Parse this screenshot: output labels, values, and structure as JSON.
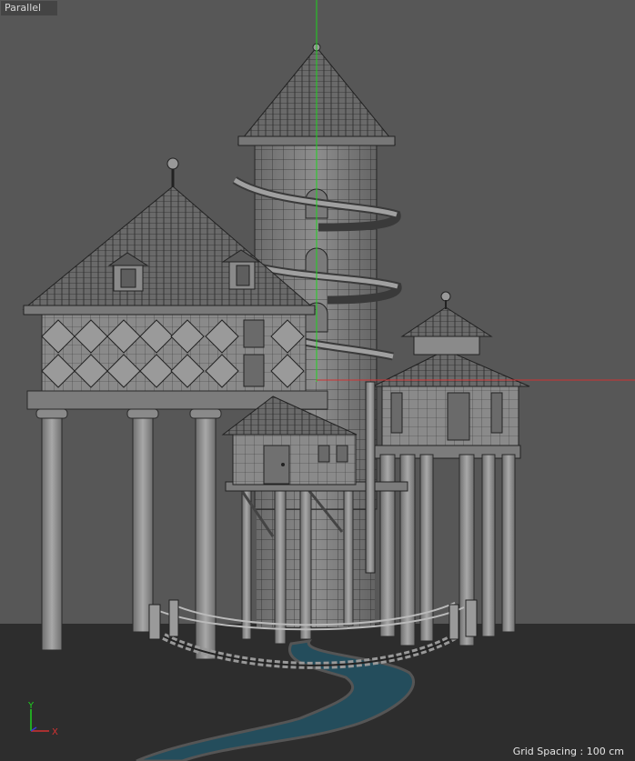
{
  "viewport": {
    "label": "Parallel",
    "grid_spacing": "Grid Spacing : 100 cm",
    "axis_x": "X",
    "axis_y": "Y"
  },
  "colors": {
    "background": "#575757",
    "ground": "#2d2d2d",
    "water": "#244d5c",
    "axis_green": "#1ed21e",
    "axis_red": "#d23232",
    "mesh": "#9a9a9a",
    "wire": "#2a2a2a"
  }
}
